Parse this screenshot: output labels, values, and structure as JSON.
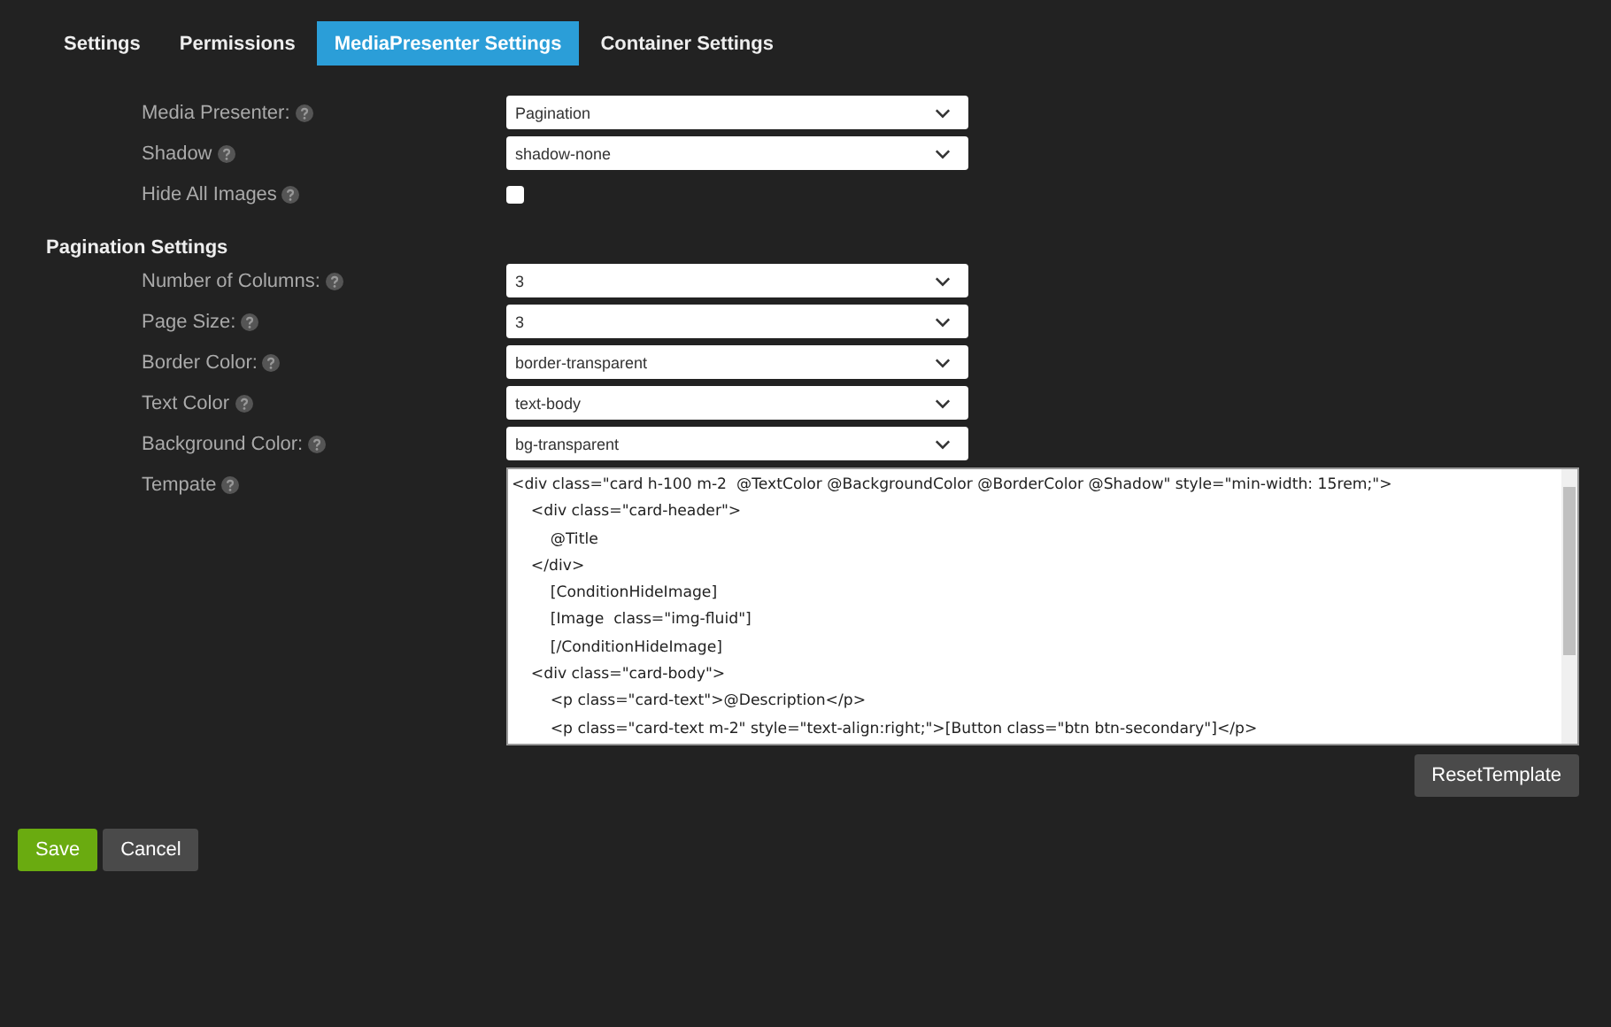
{
  "tabs": [
    {
      "label": "Settings",
      "selected": false
    },
    {
      "label": "Permissions",
      "selected": false
    },
    {
      "label": "MediaPresenter Settings",
      "selected": true
    },
    {
      "label": "Container Settings",
      "selected": false
    }
  ],
  "general_fields": [
    {
      "kind": "select",
      "label": "Media Presenter:",
      "value": "Pagination"
    },
    {
      "kind": "select",
      "label": "Shadow",
      "value": "shadow-none"
    },
    {
      "kind": "checkbox",
      "label": "Hide All Images",
      "checked": false
    }
  ],
  "pagination_settings": {
    "title": "Pagination Settings",
    "fields": [
      {
        "kind": "select",
        "label": "Number of Columns:",
        "value": "3"
      },
      {
        "kind": "select",
        "label": "Page Size:",
        "value": "3"
      },
      {
        "kind": "select",
        "label": "Border Color:",
        "value": "border-transparent"
      },
      {
        "kind": "select",
        "label": "Text Color",
        "value": "text-body"
      },
      {
        "kind": "select",
        "label": "Background Color:",
        "value": "bg-transparent"
      }
    ],
    "template": {
      "label": "Tempate",
      "lines": [
        "<div class=\"card h-100 m-2  @TextColor @BackgroundColor @BorderColor @Shadow\" style=\"min-width: 15rem;\">",
        "    <div class=\"card-header\">",
        "        @Title",
        "    </div>",
        "        [ConditionHideImage]",
        "        [Image  class=\"img-fluid\"]",
        "        [/ConditionHideImage]",
        "    <div class=\"card-body\">",
        "        <p class=\"card-text\">@Description</p>",
        "        <p class=\"card-text m-2\" style=\"text-align:right;\">[Button class=\"btn btn-secondary\"]</p>"
      ]
    },
    "reset_button": "ResetTemplate"
  },
  "buttons": [
    {
      "kind": "primary",
      "label": "Save"
    },
    {
      "kind": "secondary",
      "label": "Cancel"
    }
  ]
}
